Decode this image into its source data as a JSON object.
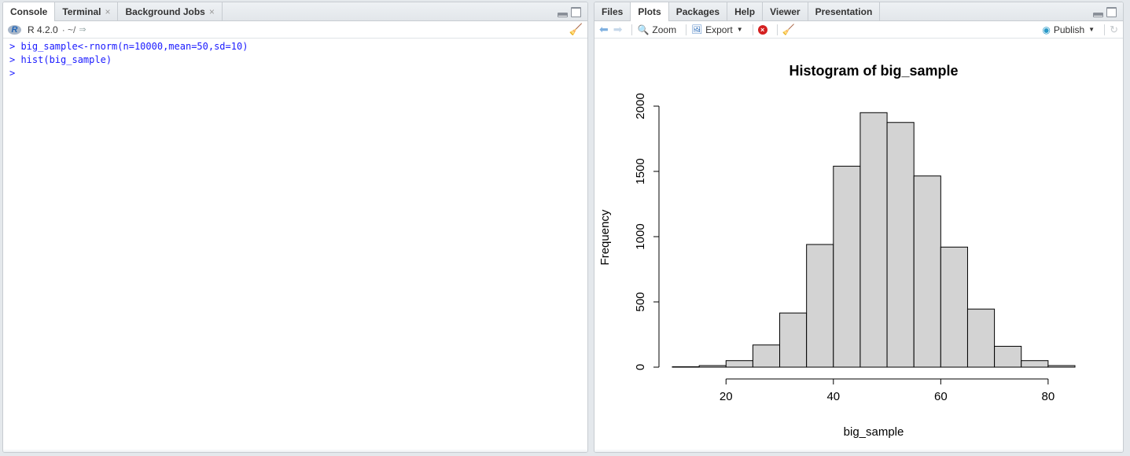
{
  "console_pane": {
    "tabs": [
      {
        "label": "Console",
        "closable": false,
        "active": true
      },
      {
        "label": "Terminal",
        "closable": true,
        "active": false
      },
      {
        "label": "Background Jobs",
        "closable": true,
        "active": false
      }
    ],
    "r_version": "R 4.2.0",
    "working_dir": "· ~/",
    "lines": [
      "> big_sample<-rnorm(n=10000,mean=50,sd=10)",
      "> hist(big_sample)",
      ">"
    ]
  },
  "viewer_pane": {
    "tabs": [
      {
        "label": "Files",
        "active": false
      },
      {
        "label": "Plots",
        "active": true
      },
      {
        "label": "Packages",
        "active": false
      },
      {
        "label": "Help",
        "active": false
      },
      {
        "label": "Viewer",
        "active": false
      },
      {
        "label": "Presentation",
        "active": false
      }
    ],
    "toolbar": {
      "zoom_label": "Zoom",
      "export_label": "Export",
      "publish_label": "Publish"
    }
  },
  "colors": {
    "console_text": "#1a1aff",
    "bar_fill": "#d3d3d3",
    "bar_stroke": "#000000",
    "accent": "#2165b6"
  },
  "chart_data": {
    "type": "bar",
    "title": "Histogram of big_sample",
    "xlabel": "big_sample",
    "ylabel": "Frequency",
    "bin_edges": [
      10,
      15,
      20,
      25,
      30,
      35,
      40,
      45,
      50,
      55,
      60,
      65,
      70,
      75,
      80,
      85
    ],
    "values": [
      3,
      12,
      50,
      170,
      415,
      940,
      1540,
      1950,
      1875,
      1465,
      920,
      445,
      160,
      50,
      12
    ],
    "xticks": [
      20,
      40,
      60,
      80
    ],
    "yticks": [
      0,
      500,
      1000,
      1500,
      2000
    ],
    "xlim": [
      10,
      85
    ],
    "ylim": [
      0,
      2000
    ],
    "grid": false
  }
}
